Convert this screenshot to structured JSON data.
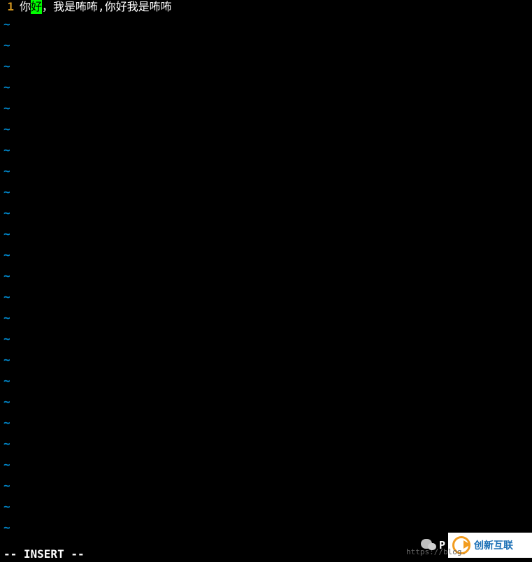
{
  "editor": {
    "lineNumber": "1",
    "textBeforeCursor": "你",
    "cursorChar": "好",
    "textAfterCursor": "，我是咘咘,你好我是咘咘",
    "tilde": "~",
    "tildeCount": 25
  },
  "status": {
    "mode": "-- INSERT --"
  },
  "watermark": {
    "wechatLabel": "P",
    "logoText": "创新互联",
    "url": "https://blog."
  }
}
